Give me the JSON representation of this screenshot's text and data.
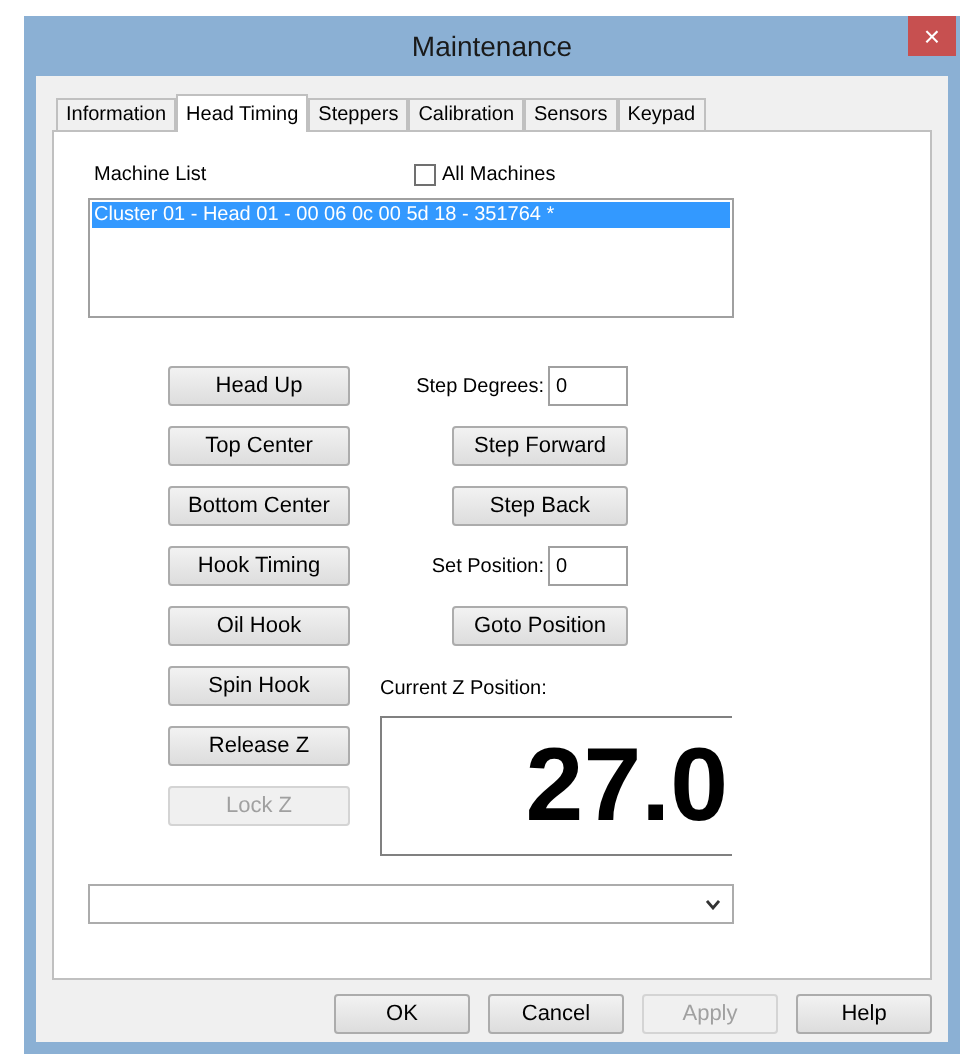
{
  "window": {
    "title": "Maintenance",
    "close": "×"
  },
  "tabs": [
    {
      "label": "Information",
      "selected": false
    },
    {
      "label": "Head Timing",
      "selected": true
    },
    {
      "label": "Steppers",
      "selected": false
    },
    {
      "label": "Calibration",
      "selected": false
    },
    {
      "label": "Sensors",
      "selected": false
    },
    {
      "label": "Keypad",
      "selected": false
    }
  ],
  "machine_list": {
    "label": "Machine List",
    "items": [
      {
        "text": "Cluster 01 - Head 01 - 00 06 0c 00 5d 18 - 351764 *",
        "selected": true
      }
    ]
  },
  "all_machines": {
    "label": "All Machines",
    "checked": false
  },
  "left_buttons": [
    {
      "label": "Head Up",
      "disabled": false
    },
    {
      "label": "Top Center",
      "disabled": false
    },
    {
      "label": "Bottom Center",
      "disabled": false
    },
    {
      "label": "Hook Timing",
      "disabled": false
    },
    {
      "label": "Oil Hook",
      "disabled": false
    },
    {
      "label": "Spin Hook",
      "disabled": false
    },
    {
      "label": "Release Z",
      "disabled": false
    },
    {
      "label": "Lock Z",
      "disabled": true
    }
  ],
  "right_rows": [
    {
      "kind": "field",
      "label": "Step Degrees:",
      "value": "0"
    },
    {
      "kind": "button",
      "label": "Step Forward"
    },
    {
      "kind": "button",
      "label": "Step Back"
    },
    {
      "kind": "field",
      "label": "Set Position:",
      "value": "0"
    },
    {
      "kind": "button",
      "label": "Goto Position"
    }
  ],
  "position": {
    "label": "Current Z Position:",
    "value": "27.0"
  },
  "footer_buttons": [
    {
      "label": "OK",
      "disabled": false
    },
    {
      "label": "Cancel",
      "disabled": false
    },
    {
      "label": "Apply",
      "disabled": true
    },
    {
      "label": "Help",
      "disabled": false
    }
  ]
}
